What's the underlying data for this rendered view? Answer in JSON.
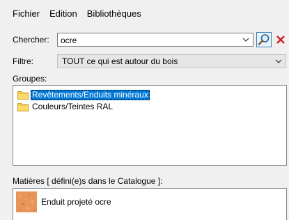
{
  "menu": {
    "items": [
      "Fichier",
      "Edition",
      "Bibliothèques"
    ]
  },
  "search": {
    "label": "Chercher:",
    "value": "ocre"
  },
  "filter": {
    "label": "Filtre:",
    "value": "TOUT ce qui est autour du bois"
  },
  "groups": {
    "label": "Groupes:",
    "items": [
      {
        "label": "Revêtements/Enduits minéraux",
        "selected": true
      },
      {
        "label": "Couleurs/Teintes RAL",
        "selected": false
      }
    ]
  },
  "materials": {
    "label": "Matières [ défini(e)s dans le Catalogue ]:",
    "items": [
      {
        "label": "Enduit projeté ocre",
        "swatch_color": "#e8955a"
      }
    ]
  },
  "colors": {
    "selection": "#0078d7",
    "folder": "#f5c94a",
    "close_red": "#d02020",
    "search_btn_bg": "#e5f1fb"
  },
  "icons": {
    "search": "magnifier-icon",
    "clear": "close-x-icon",
    "dropdown": "chevron-down-icon",
    "folder": "folder-icon"
  }
}
